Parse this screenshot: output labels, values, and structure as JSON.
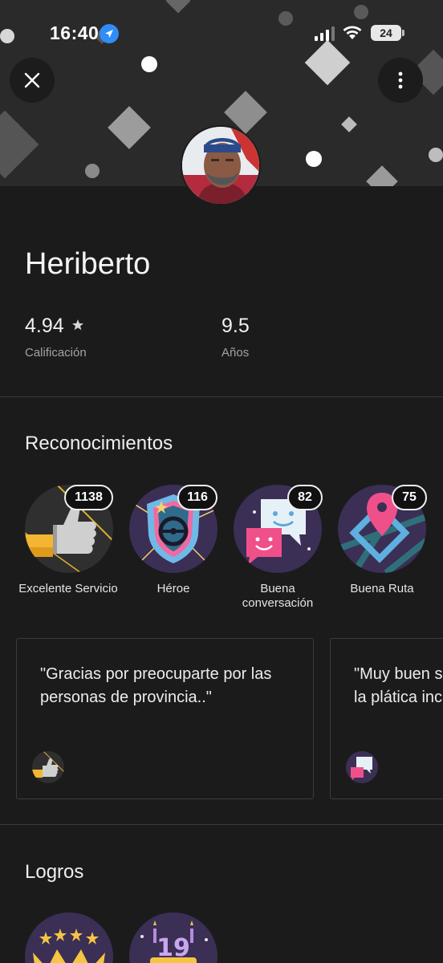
{
  "status_bar": {
    "time": "16:40",
    "battery": "24",
    "icons": [
      "location-arrow-icon",
      "signal-icon",
      "wifi-icon",
      "battery-icon"
    ]
  },
  "header": {
    "close_icon": "close-icon",
    "more_icon": "more-vertical-icon"
  },
  "profile": {
    "name": "Heriberto",
    "rating": "4.94",
    "rating_icon": "star-icon",
    "rating_label": "Calificación",
    "years": "9.5",
    "years_label": "Años"
  },
  "recognitions": {
    "title": "Reconocimientos",
    "badges": [
      {
        "label": "Excelente Servicio",
        "count": "1138",
        "icon": "thumbs-up-icon"
      },
      {
        "label": "Héroe",
        "count": "116",
        "icon": "hero-shield-icon"
      },
      {
        "label": "Buena conversación",
        "count": "82",
        "icon": "chat-bubbles-icon"
      },
      {
        "label": "Buena Ruta",
        "count": "75",
        "icon": "map-route-icon"
      }
    ],
    "comments": [
      {
        "text": "\"Gracias por preocuparte por las personas de provincia..\"",
        "icon": "thumbs-up-icon"
      },
      {
        "text": "\"Muy buen s\nla plática inc",
        "icon": "chat-bubbles-icon"
      }
    ]
  },
  "achievements": {
    "title": "Logros",
    "icons": [
      "crown-stars-icon",
      "trips-cake-icon"
    ]
  },
  "colors": {
    "background": "#1b1b1b",
    "banner": "#2a2a2a",
    "location_blue": "#2f8df7",
    "badge_purple": "#3b2f55"
  }
}
